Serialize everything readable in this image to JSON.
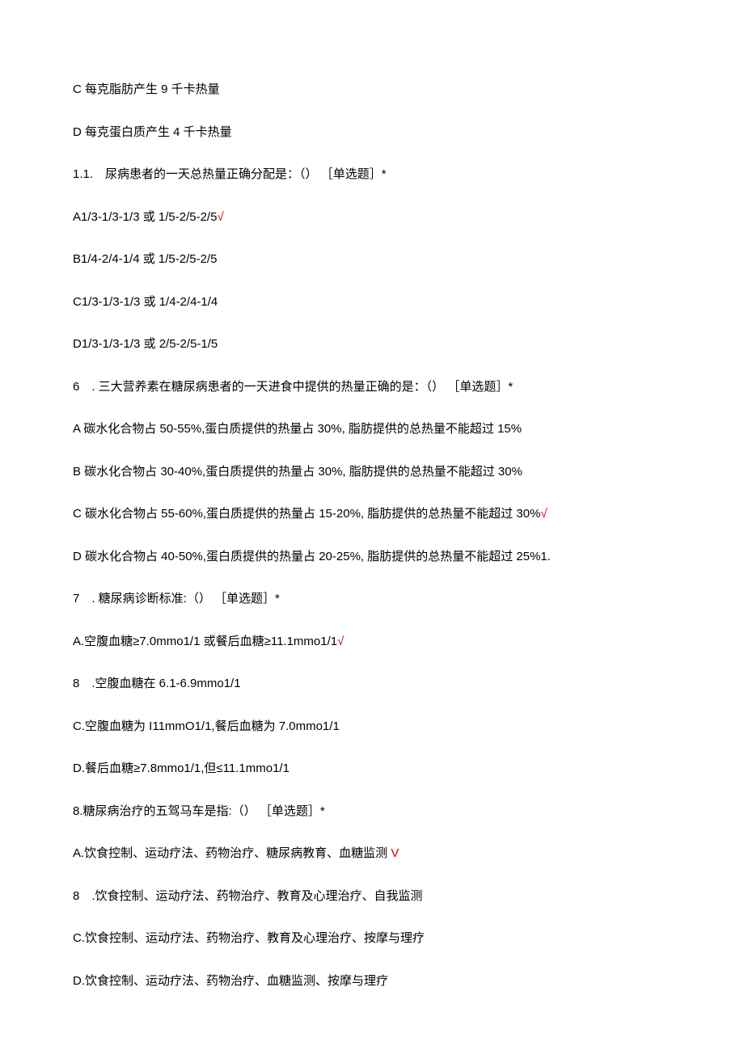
{
  "lines": [
    {
      "text": "C 每克脂肪产生 9 千卡热量",
      "mark": ""
    },
    {
      "text": "D 每克蛋白质产生 4 千卡热量",
      "mark": ""
    },
    {
      "text": "1.1.　尿病患者的一天总热量正确分配是：（） ［单选题］*",
      "mark": ""
    },
    {
      "text": "A1/3-1/3-1/3 或 1/5-2/5-2/5",
      "mark": "√"
    },
    {
      "text": "B1/4-2/4-1/4 或 1/5-2/5-2/5",
      "mark": ""
    },
    {
      "text": "C1/3-1/3-1/3 或 1/4-2/4-1/4",
      "mark": ""
    },
    {
      "text": "D1/3-1/3-1/3 或 2/5-2/5-1/5",
      "mark": ""
    },
    {
      "text": "6　. 三大营养素在糖尿病患者的一天进食中提供的热量正确的是：（） ［单选题］*",
      "mark": ""
    },
    {
      "text": "A 碳水化合物占 50-55%,蛋白质提供的热量占 30%, 脂肪提供的总热量不能超过 15%",
      "mark": ""
    },
    {
      "text": "B 碳水化合物占 30-40%,蛋白质提供的热量占 30%, 脂肪提供的总热量不能超过 30%",
      "mark": ""
    },
    {
      "text": "C 碳水化合物占 55-60%,蛋白质提供的热量占 15-20%, 脂肪提供的总热量不能超过 30%",
      "mark": "√"
    },
    {
      "text": "D 碳水化合物占 40-50%,蛋白质提供的热量占 20-25%, 脂肪提供的总热量不能超过 25%1.",
      "mark": ""
    },
    {
      "text": "7　. 糖尿病诊断标准:（） ［单选题］*",
      "mark": ""
    },
    {
      "text": "A.空腹血糖≥7.0mmo1/1 或餐后血糖≥11.1mmo1/1",
      "mark": "√"
    },
    {
      "text": "8　.空腹血糖在 6.1-6.9mmo1/1",
      "mark": ""
    },
    {
      "text": "C.空腹血糖为 I11mmO1/1,餐后血糖为 7.0mmo1/1",
      "mark": ""
    },
    {
      "text": "D.餐后血糖≥7.8mmo1/1,但≤11.1mmo1/1",
      "mark": ""
    },
    {
      "text": "8.糖尿病治疗的五驾马车是指:（） ［单选题］*",
      "mark": ""
    },
    {
      "text": "A.饮食控制、运动疗法、药物治疗、糖尿病教育、血糖监测 ",
      "mark": "V"
    },
    {
      "text": "8　.饮食控制、运动疗法、药物治疗、教育及心理治疗、自我监测",
      "mark": ""
    },
    {
      "text": "C.饮食控制、运动疗法、药物治疗、教育及心理治疗、按摩与理疗",
      "mark": ""
    },
    {
      "text": "D.饮食控制、运动疗法、药物治疗、血糖监测、按摩与理疗",
      "mark": ""
    }
  ]
}
